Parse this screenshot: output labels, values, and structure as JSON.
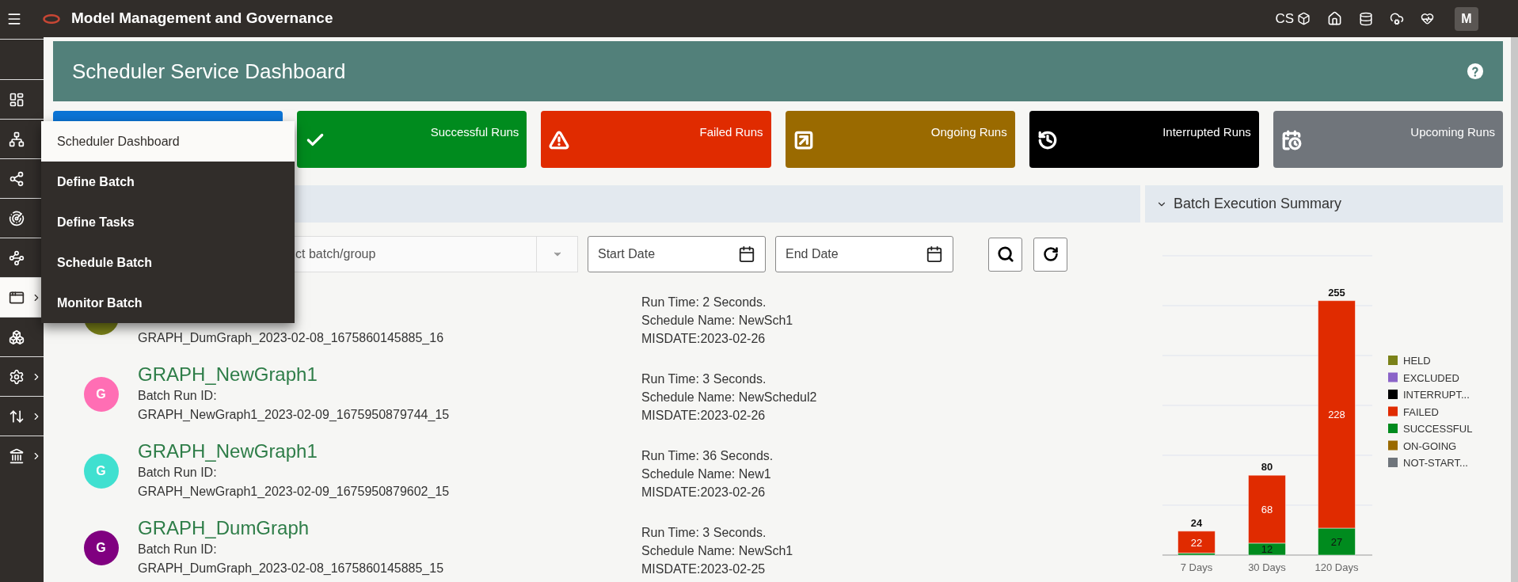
{
  "header": {
    "title": "Model Management and Governance",
    "user_code": "CS",
    "avatar": "M"
  },
  "sidebar": {
    "items": [
      {
        "selected": false,
        "expandable": false
      },
      {
        "selected": false,
        "expandable": false
      },
      {
        "selected": false,
        "expandable": false
      },
      {
        "selected": false,
        "expandable": false
      },
      {
        "selected": false,
        "expandable": false
      },
      {
        "selected": true,
        "expandable": true
      },
      {
        "selected": false,
        "expandable": false
      },
      {
        "selected": false,
        "expandable": true
      },
      {
        "selected": false,
        "expandable": true
      },
      {
        "selected": false,
        "expandable": true
      }
    ]
  },
  "menu": {
    "items": [
      {
        "label": "Scheduler Dashboard",
        "selected": true
      },
      {
        "label": "Define Batch",
        "selected": false
      },
      {
        "label": "Define Tasks",
        "selected": false
      },
      {
        "label": "Schedule Batch",
        "selected": false
      },
      {
        "label": "Monitor Batch",
        "selected": false
      }
    ]
  },
  "page_title": "Scheduler Service Dashboard",
  "cards": [
    {
      "kind": "all",
      "color": "#0b74d6"
    },
    {
      "kind": "successful",
      "label": "Successful Runs",
      "color": "#008b1e"
    },
    {
      "kind": "failed",
      "label": "Failed Runs",
      "color": "#e02b00"
    },
    {
      "kind": "ongoing",
      "label": "Ongoing Runs",
      "color": "#9a6a00"
    },
    {
      "kind": "interrupted",
      "label": "Interrupted Runs",
      "color": "#000000"
    },
    {
      "kind": "upcoming",
      "label": "Upcoming Runs",
      "color": "#70757b"
    }
  ],
  "summary_panel": {
    "title": "Batch Execution Summary",
    "expanded": true
  },
  "filters": {
    "batch_select": {
      "placeholder": "ct batch/group"
    },
    "start_date": {
      "placeholder": "Start Date"
    },
    "end_date": {
      "placeholder": "End Date"
    }
  },
  "runs": [
    {
      "color": "#7b8219",
      "run_id": "GRAPH_DumGraph_2023-02-08_1675860145885_16",
      "run_time": "Run Time: 2 Seconds.",
      "schedule": "Schedule Name: NewSch1",
      "misdate": "MISDATE:2023-02-26"
    },
    {
      "color": "#ff6eb4",
      "avatar": "G",
      "name": "GRAPH_NewGraph1",
      "run_id_label": "Batch Run ID:",
      "run_id": "GRAPH_NewGraph1_2023-02-09_1675950879744_15",
      "run_time": "Run Time: 3 Seconds.",
      "schedule": "Schedule Name: NewSchedul2",
      "misdate": "MISDATE:2023-02-26"
    },
    {
      "color": "#40e0d0",
      "avatar": "G",
      "name": "GRAPH_NewGraph1",
      "run_id_label": "Batch Run ID:",
      "run_id": "GRAPH_NewGraph1_2023-02-09_1675950879602_15",
      "run_time": "Run Time: 36 Seconds.",
      "schedule": "Schedule Name: New1",
      "misdate": "MISDATE:2023-02-26"
    },
    {
      "color": "#800080",
      "avatar": "G",
      "name": "GRAPH_DumGraph",
      "run_id_label": "Batch Run ID:",
      "run_id": "GRAPH_DumGraph_2023-02-08_1675860145885_15",
      "run_time": "Run Time: 3 Seconds.",
      "schedule": "Schedule Name: NewSch1",
      "misdate": "MISDATE:2023-02-25"
    }
  ],
  "chart_data": {
    "type": "bar",
    "stacked": true,
    "categories": [
      "7 Days",
      "30 Days",
      "120 Days"
    ],
    "ylim": [
      0,
      300
    ],
    "legend": "right",
    "series": [
      {
        "name": "HELD",
        "color": "#7b8219",
        "values": [
          0,
          0,
          0
        ]
      },
      {
        "name": "EXCLUDED",
        "color": "#8b64c8",
        "values": [
          0,
          0,
          0
        ]
      },
      {
        "name": "INTERRUPT...",
        "color": "#000000",
        "values": [
          0,
          0,
          0
        ]
      },
      {
        "name": "FAILED",
        "color": "#e02b00",
        "values": [
          22,
          68,
          228
        ],
        "value_labels": [
          "22",
          "68",
          "228"
        ]
      },
      {
        "name": "SUCCESSFUL",
        "color": "#008b1e",
        "values": [
          2,
          12,
          27
        ],
        "value_labels": [
          null,
          "12",
          "27"
        ]
      },
      {
        "name": "ON-GOING",
        "color": "#9a6a00",
        "values": [
          0,
          0,
          0
        ]
      },
      {
        "name": "NOT-START...",
        "color": "#6f757b",
        "values": [
          0,
          0,
          0
        ]
      }
    ],
    "annotations": [
      "24",
      "80",
      "255"
    ]
  }
}
